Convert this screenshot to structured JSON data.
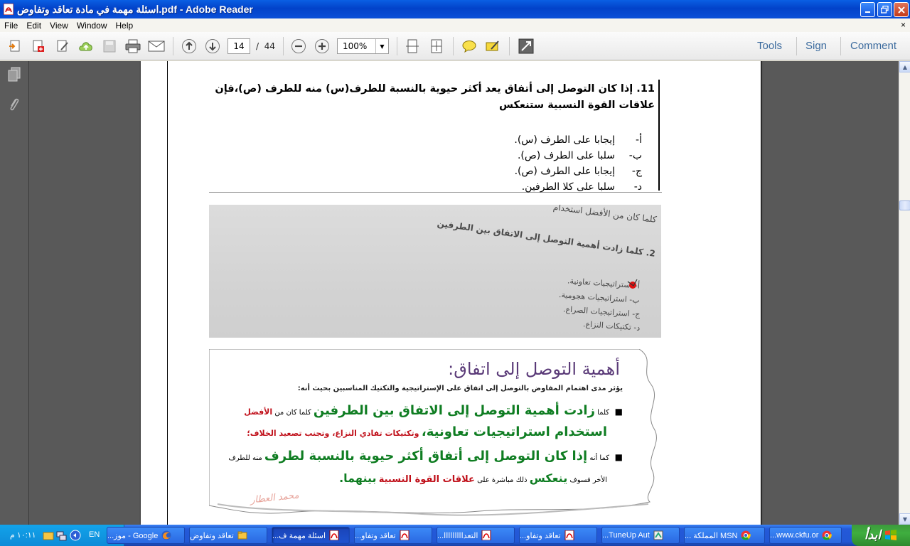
{
  "window": {
    "title": "اسئلة مهمة في مادة تعاقد وتفاوض.pdf - Adobe Reader"
  },
  "menu": [
    "File",
    "Edit",
    "View",
    "Window",
    "Help"
  ],
  "menu_close": "×",
  "toolbar": {
    "page_current": "14",
    "page_separator": "/",
    "page_total": "44",
    "zoom": "100%",
    "tools": "Tools",
    "sign": "Sign",
    "comment": "Comment"
  },
  "q11": {
    "text": "11. إذا كان التوصل إلى أتفاق يعد أكثر حيوية بالنسبة للطرف(س) منه للطرف (ص)،فإن علاقات القوة النسبية ستنعكس",
    "options": [
      {
        "letter": "أ-",
        "text": "إيجابا على الطرف (س)."
      },
      {
        "letter": "ب-",
        "text": "سلبا على الطرف (ص)."
      },
      {
        "letter": "ج-",
        "text": "إيجابا على الطرف (ص)."
      },
      {
        "letter": "د-",
        "text": "سلبا على كلا الطرفين."
      }
    ]
  },
  "photo": {
    "question_line1": "كلما كان من الأفضل استخدام",
    "question_line2": "2. كلما زادت أهمية التوصل إلى الاتفاق بين الطرفين",
    "options": [
      "أ- استراتيجيات تعاونية.",
      "ب- استراتيجيات هجومية.",
      "ج- استراتيجيات الصراع.",
      "د- تكتيكات النزاع."
    ]
  },
  "slide": {
    "heading": "أهمية التوصل إلى اتفاق:",
    "intro": "يؤثر مدى اهتمام المفاوض بالتوصل إلى اتفاق على الإستراتيجية والتكتيك المناسبين بحيث أنه:",
    "b1_small1": "كلما",
    "b1_big": "زادت أهمية التوصل إلى الاتفاق بين الطرفين",
    "b1_small2": "كلما كان من",
    "b1_red": "الأفضل",
    "b1_line2_big": "استخدام استراتيجيات تعاونية،",
    "b1_line2_red": "وتكتيكات تفادي النزاع، وتجنب تصعيد الخلاف؛",
    "b2_small1": "كما أنه",
    "b2_big": "إذا كان التوصل إلى أتفاق أكثر حيوية بالنسبة لطرف",
    "b2_small2": "منه للطرف",
    "b2_line2_small": "الأخر فسوف",
    "b2_line2_green": "ينعكس",
    "b2_line2_small2": "ذلك مباشرة على",
    "b2_line2_red": "علاقات القوة النسبية",
    "b2_line2_green2": "بينهما.",
    "signature": "محمد العطار"
  },
  "taskbar": {
    "start": "ابدأ",
    "clock": "١٠:١١ م",
    "lang": "EN",
    "items": [
      {
        "label": "www.ckfu.or...",
        "icon": "chrome"
      },
      {
        "label": "MSN المملكة ...",
        "icon": "chrome"
      },
      {
        "label": "TuneUp Aut...",
        "icon": "tuneup"
      },
      {
        "label": "تعاقد وتفاو...",
        "icon": "pdf"
      },
      {
        "label": "التعدااااااااا...",
        "icon": "pdf"
      },
      {
        "label": "تعاقد وتفاو...",
        "icon": "pdf"
      },
      {
        "label": "اسئلة مهمة ف...",
        "icon": "pdf",
        "active": true
      },
      {
        "label": "تعاقد وتفاوض",
        "icon": "folder"
      },
      {
        "label": "Google - موز...",
        "icon": "firefox"
      }
    ]
  },
  "colors": {
    "green": "#0f7d22",
    "red": "#c0101a",
    "purple": "#5a3a78"
  }
}
